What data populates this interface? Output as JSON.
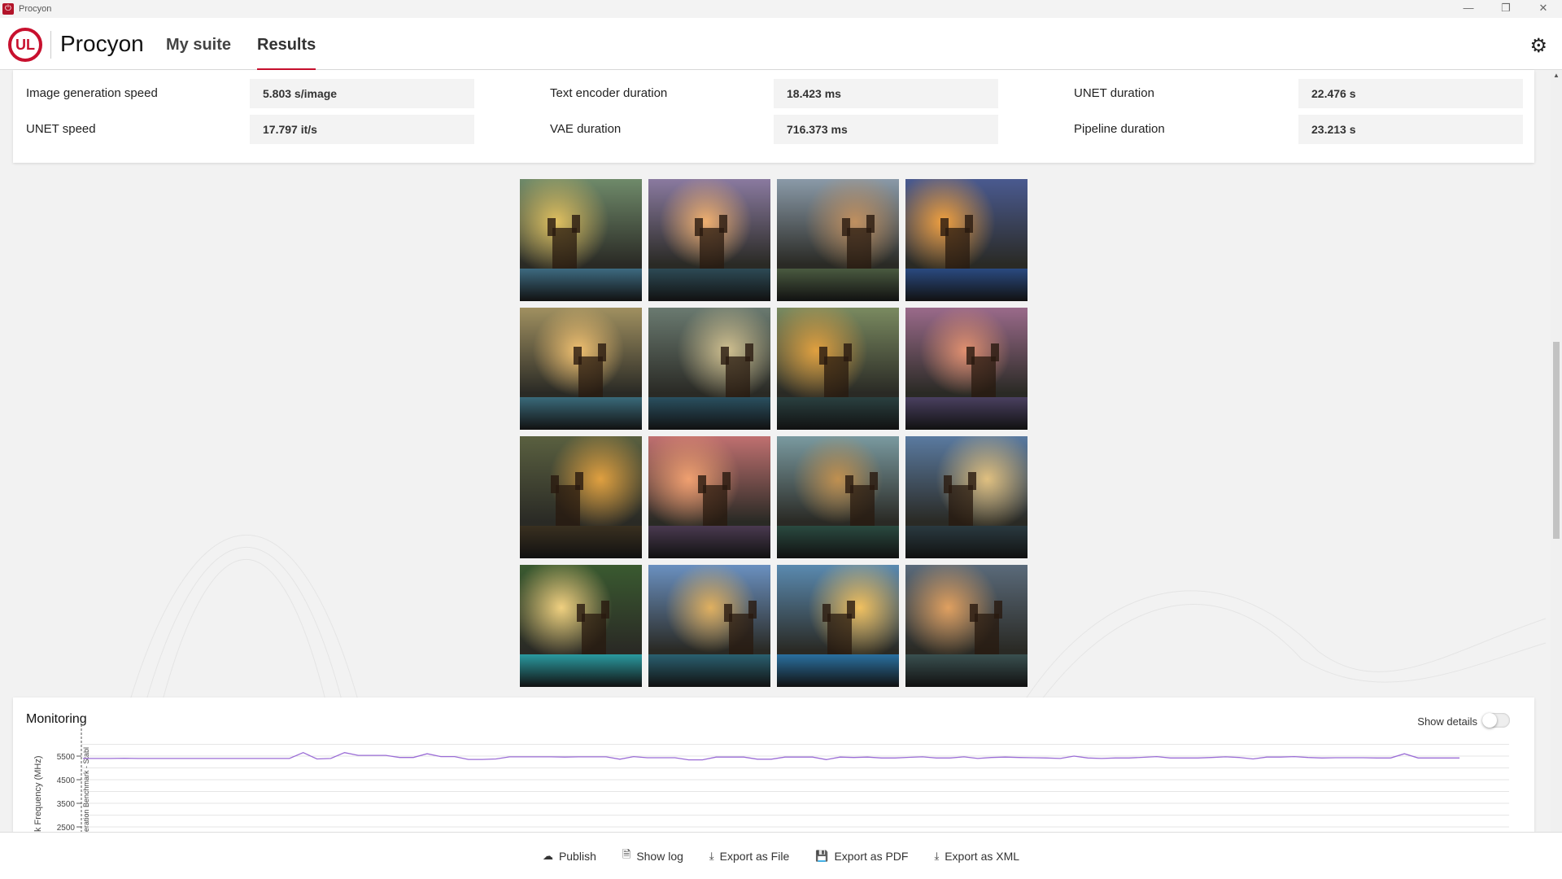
{
  "window": {
    "title": "Procyon",
    "minimize": "—",
    "restore": "❐",
    "close": "✕"
  },
  "header": {
    "logo": "UL",
    "brand": "Procyon",
    "tabs": [
      {
        "label": "My suite"
      },
      {
        "label": "Results",
        "active": true
      }
    ],
    "settings_icon": "gear-icon"
  },
  "metrics": [
    {
      "label": "Image generation speed",
      "value": "5.803 s/image"
    },
    {
      "label": "Text encoder duration",
      "value": "18.423 ms"
    },
    {
      "label": "UNET duration",
      "value": "22.476 s"
    },
    {
      "label": "UNET speed",
      "value": "17.797 it/s"
    },
    {
      "label": "VAE duration",
      "value": "716.373 ms"
    },
    {
      "label": "Pipeline duration",
      "value": "23.213 s"
    }
  ],
  "images": [
    {
      "sky": "#6f8a6a",
      "glow": "#e0c060",
      "water": "#3d6a80"
    },
    {
      "sky": "#8a7aa0",
      "glow": "#f0b070",
      "water": "#2d4a55"
    },
    {
      "sky": "#8a9aa8",
      "glow": "#c09060",
      "water": "#4a5a40"
    },
    {
      "sky": "#4a5a90",
      "glow": "#f0a040",
      "water": "#2a4a80"
    },
    {
      "sky": "#a09060",
      "glow": "#f0c070",
      "water": "#3a6a7a"
    },
    {
      "sky": "#6a7a70",
      "glow": "#d0c090",
      "water": "#2a5060"
    },
    {
      "sky": "#7a8a60",
      "glow": "#e0a040",
      "water": "#2a4040"
    },
    {
      "sky": "#9a6a8a",
      "glow": "#e09070",
      "water": "#4a4060"
    },
    {
      "sky": "#5a6040",
      "glow": "#e0a040",
      "water": "#3a3020"
    },
    {
      "sky": "#c07070",
      "glow": "#f0a070",
      "water": "#4a3a50"
    },
    {
      "sky": "#7a9aa0",
      "glow": "#c09050",
      "water": "#2a4a40"
    },
    {
      "sky": "#5a7aa0",
      "glow": "#e0c080",
      "water": "#2a3a40"
    },
    {
      "sky": "#3a5a30",
      "glow": "#f0d080",
      "water": "#2a9aa0"
    },
    {
      "sky": "#6a90c0",
      "glow": "#e0b060",
      "water": "#2a6070"
    },
    {
      "sky": "#5a8ab0",
      "glow": "#f0c060",
      "water": "#2a70a0"
    },
    {
      "sky": "#5a6a7a",
      "glow": "#e0a060",
      "water": "#3a5050"
    }
  ],
  "monitoring": {
    "title": "Monitoring",
    "show_details": "Show details",
    "show_details_on": false
  },
  "chart_data": {
    "type": "line",
    "ylabel": "k Frequency (MHz)",
    "marker_label": "eration Benchmark - Stabl",
    "yticks": [
      "5500",
      "4500",
      "3500",
      "2500"
    ],
    "ytick_values": [
      5500,
      4500,
      3500,
      2500
    ],
    "ylim": [
      2000,
      6000
    ],
    "line_color": "#9b6dd6",
    "series": [
      {
        "name": "CPU Clock Frequency",
        "values": [
          5400,
          5400,
          5400,
          5410,
          5400,
          5400,
          5400,
          5400,
          5400,
          5400,
          5400,
          5400,
          5400,
          5400,
          5400,
          5400,
          5650,
          5380,
          5400,
          5650,
          5530,
          5530,
          5530,
          5440,
          5440,
          5600,
          5480,
          5480,
          5360,
          5360,
          5380,
          5470,
          5470,
          5470,
          5470,
          5460,
          5470,
          5470,
          5470,
          5370,
          5480,
          5430,
          5430,
          5430,
          5340,
          5340,
          5460,
          5460,
          5460,
          5370,
          5370,
          5460,
          5460,
          5460,
          5350,
          5460,
          5440,
          5460,
          5420,
          5420,
          5450,
          5470,
          5420,
          5420,
          5470,
          5400,
          5440,
          5460,
          5440,
          5430,
          5420,
          5400,
          5500,
          5420,
          5400,
          5420,
          5420,
          5450,
          5480,
          5420,
          5420,
          5420,
          5440,
          5470,
          5440,
          5380,
          5460,
          5460,
          5480,
          5440,
          5420,
          5430,
          5430,
          5430,
          5420,
          5420,
          5600,
          5420,
          5420,
          5420,
          5420
        ]
      }
    ]
  },
  "footer": [
    {
      "label": "Publish",
      "icon": "cloud-upload-icon",
      "glyph": "☁"
    },
    {
      "label": "Show log",
      "icon": "document-icon",
      "glyph": "🗎"
    },
    {
      "label": "Export as File",
      "icon": "download-icon",
      "glyph": "⤓"
    },
    {
      "label": "Export as PDF",
      "icon": "save-icon",
      "glyph": "💾"
    },
    {
      "label": "Export as XML",
      "icon": "download-icon",
      "glyph": "⤓"
    }
  ]
}
